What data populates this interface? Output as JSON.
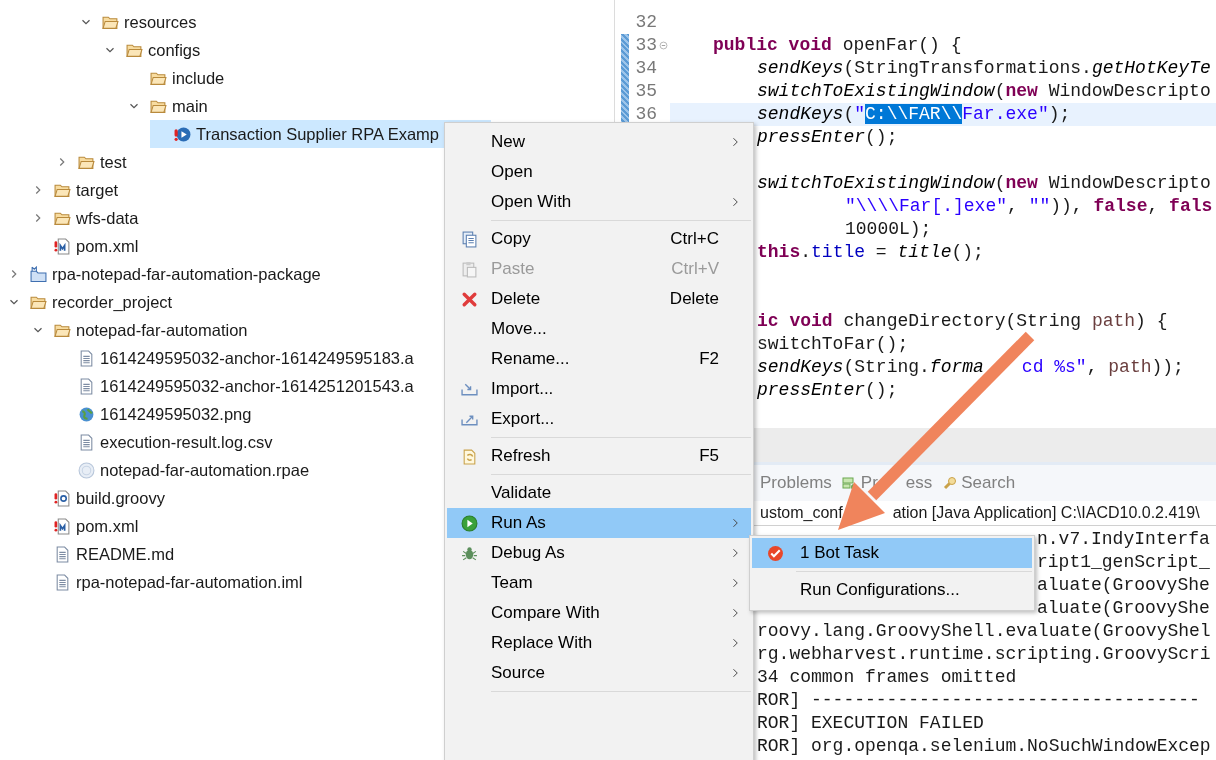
{
  "project_tree": {
    "items": [
      {
        "children": [
          {
            "children": [
              {
                "children": [
                  {
                    "label": "resources",
                    "kind": "folder",
                    "expanded": true,
                    "selected": false,
                    "children": [
                      {
                        "label": "configs",
                        "kind": "folder",
                        "expanded": true,
                        "selected": false,
                        "children": [
                          {
                            "label": "include",
                            "kind": "folder",
                            "selected": false
                          },
                          {
                            "label": "main",
                            "kind": "folder",
                            "expanded": true,
                            "selected": false,
                            "children": [
                              {
                                "label": "Transaction Supplier RPA Examp",
                                "kind": "bot",
                                "selected": true
                              }
                            ]
                          }
                        ]
                      }
                    ]
                  }
                ]
              },
              {
                "label": "test",
                "kind": "folder",
                "expanded": false,
                "selected": false
              }
            ]
          },
          {
            "label": "target",
            "kind": "folder",
            "expanded": false,
            "selected": false
          },
          {
            "label": "wfs-data",
            "kind": "folder",
            "expanded": false,
            "selected": false
          },
          {
            "label": "pom.xml",
            "kind": "maven",
            "selected": false
          }
        ]
      },
      {
        "label": "rpa-notepad-far-automation-package",
        "kind": "package",
        "expanded": false,
        "selected": false
      },
      {
        "label": "recorder_project",
        "kind": "folder",
        "expanded": true,
        "selected": false,
        "children": [
          {
            "label": "notepad-far-automation",
            "kind": "folder",
            "expanded": true,
            "selected": false,
            "children": [
              {
                "label": "1614249595032-anchor-1614249595183.a",
                "kind": "file",
                "selected": false
              },
              {
                "label": "1614249595032-anchor-1614251201543.a",
                "kind": "file",
                "selected": false
              },
              {
                "label": "1614249595032.png",
                "kind": "image",
                "selected": false
              },
              {
                "label": "execution-result.log.csv",
                "kind": "file",
                "selected": false
              },
              {
                "label": "notepad-far-automation.rpae",
                "kind": "rpae",
                "selected": false
              }
            ]
          },
          {
            "label": "build.groovy",
            "kind": "groovy",
            "selected": false
          },
          {
            "label": "pom.xml",
            "kind": "maven",
            "selected": false
          },
          {
            "label": "README.md",
            "kind": "file",
            "selected": false
          },
          {
            "label": "rpa-notepad-far-automation.iml",
            "kind": "file",
            "selected": false
          }
        ]
      }
    ]
  },
  "editor": {
    "lines": [
      {
        "number": "32",
        "kind": "member"
      },
      {
        "number": "33",
        "kind": "member",
        "changed": true,
        "foldable": true,
        "tokens": [
          {
            "text": "public void",
            "kind": "keyword"
          },
          {
            "text": " openFar() {",
            "kind": "plain"
          }
        ]
      },
      {
        "number": "34",
        "kind": "body",
        "changed": true,
        "tokens": [
          {
            "text": "sendKeys",
            "kind": "italic"
          },
          {
            "text": "(StringTransformations.",
            "kind": "plain"
          },
          {
            "text": "getHotKeyTe",
            "kind": "italic"
          }
        ]
      },
      {
        "number": "35",
        "kind": "body",
        "changed": true,
        "tokens": [
          {
            "text": "switchToExistingWindow",
            "kind": "italic"
          },
          {
            "text": "(",
            "kind": "plain"
          },
          {
            "text": "new",
            "kind": "keyword"
          },
          {
            "text": " WindowDescripto",
            "kind": "plain"
          }
        ]
      },
      {
        "number": "36",
        "kind": "body",
        "changed": true,
        "current": true,
        "tokens": [
          {
            "text": "sendKeys",
            "kind": "italic"
          },
          {
            "text": "(",
            "kind": "plain"
          },
          {
            "text": "\"",
            "kind": "string"
          },
          {
            "text": "C:\\\\FAR\\\\",
            "kind": "selection"
          },
          {
            "text": "Far.exe\"",
            "kind": "string"
          },
          {
            "text": ");",
            "kind": "plain"
          }
        ]
      },
      {
        "kind": "body",
        "tokens": [
          {
            "text": "pressEnter",
            "kind": "italic"
          },
          {
            "text": "();",
            "kind": "plain"
          }
        ]
      },
      {
        "kind": "body"
      },
      {
        "kind": "body",
        "tokens": [
          {
            "text": "switchToExistingWindow",
            "kind": "italic"
          },
          {
            "text": "(",
            "kind": "plain"
          },
          {
            "text": "new",
            "kind": "keyword"
          },
          {
            "text": " WindowDescripto",
            "kind": "plain"
          }
        ]
      },
      {
        "kind": "wrap",
        "tokens": [
          {
            "text": "\"\\\\\\\\Far[.]exe\"",
            "kind": "string"
          },
          {
            "text": ", ",
            "kind": "plain"
          },
          {
            "text": "\"\"",
            "kind": "string"
          },
          {
            "text": ")), ",
            "kind": "plain"
          },
          {
            "text": "false",
            "kind": "keyword"
          },
          {
            "text": ", ",
            "kind": "plain"
          },
          {
            "text": "fals",
            "kind": "keyword"
          }
        ]
      },
      {
        "kind": "wrap",
        "tokens": [
          {
            "text": "10000L);",
            "kind": "plain"
          }
        ]
      },
      {
        "kind": "body",
        "tokens": [
          {
            "text": "this",
            "kind": "keyword"
          },
          {
            "text": ".",
            "kind": "plain"
          },
          {
            "text": "title",
            "kind": "field"
          },
          {
            "text": " = ",
            "kind": "plain"
          },
          {
            "text": "title",
            "kind": "italic"
          },
          {
            "text": "();",
            "kind": "plain"
          }
        ]
      },
      {
        "kind": "body"
      },
      {
        "kind": "body"
      },
      {
        "kind": "body",
        "tokens": [
          {
            "text": "ic void",
            "kind": "keyword"
          },
          {
            "text": " changeDirectory(String ",
            "kind": "plain"
          },
          {
            "text": "path",
            "kind": "param"
          },
          {
            "text": ") {",
            "kind": "plain"
          }
        ]
      },
      {
        "kind": "body",
        "tokens": [
          {
            "text": "switchToFar();",
            "kind": "plain"
          }
        ]
      },
      {
        "kind": "body",
        "tokens": [
          {
            "text": "sendKeys",
            "kind": "italic"
          },
          {
            "text": "(String.",
            "kind": "plain"
          },
          {
            "text": "forma",
            "kind": "italic"
          },
          {
            "text": "cd %s\"",
            "kind": "gapstring"
          },
          {
            "text": ", ",
            "kind": "plain"
          },
          {
            "text": "path",
            "kind": "param"
          },
          {
            "text": "));",
            "kind": "plain"
          }
        ]
      },
      {
        "kind": "body",
        "tokens": [
          {
            "text": "pressEnter",
            "kind": "italic"
          },
          {
            "text": "();",
            "kind": "plain"
          }
        ]
      }
    ]
  },
  "bottom_panel": {
    "tabs": [
      {
        "label_parts": [
          "Problems"
        ],
        "kind": "plain",
        "selected": false
      },
      {
        "label_parts": [
          "Pr",
          "ess"
        ],
        "kind": "progress",
        "selected": false
      },
      {
        "label_parts": [
          "Search"
        ],
        "kind": "search",
        "selected": false
      }
    ],
    "console_title_parts": [
      "ustom_conf",
      "ation [Java Application] C:\\IACD10.0.2.419\\"
    ],
    "console_lines": [
      {
        "text": "n.v7.IndyInterfa",
        "kind": "beside"
      },
      {
        "text": "ript1_genScript_",
        "kind": "beside"
      },
      {
        "text": "aluate(GroovyShe",
        "kind": "beside"
      },
      {
        "text": "aluate(GroovyShe",
        "kind": "beside"
      },
      {
        "text": "roovy.lang.GroovyShell.evaluate(GroovyShel",
        "kind": "plain"
      },
      {
        "text": "rg.webharvest.runtime.scripting.GroovyScri",
        "kind": "plain"
      },
      {
        "text": "34 common frames omitted",
        "kind": "plain"
      },
      {
        "text": "ROR] ------------------------------------",
        "kind": "plain"
      },
      {
        "text": "ROR] EXECUTION FAILED",
        "kind": "plain"
      },
      {
        "text": "ROR] org.openqa.selenium.NoSuchWindowExcep",
        "kind": "plain"
      }
    ]
  },
  "context_menu": {
    "items": [
      {
        "kind": "plain",
        "label": "New",
        "submenu": true,
        "disabled": false,
        "selected": false
      },
      {
        "kind": "plain",
        "label": "Open",
        "disabled": false,
        "selected": false
      },
      {
        "kind": "plain",
        "label": "Open With",
        "submenu": true,
        "disabled": false,
        "selected": false
      },
      {
        "kind": "separator"
      },
      {
        "kind": "copy",
        "label": "Copy",
        "shortcut": "Ctrl+C",
        "disabled": false,
        "selected": false
      },
      {
        "kind": "paste",
        "label": "Paste",
        "shortcut": "Ctrl+V",
        "disabled": true,
        "selected": false
      },
      {
        "kind": "delete",
        "label": "Delete",
        "shortcut": "Delete",
        "disabled": false,
        "selected": false
      },
      {
        "kind": "plain",
        "label": "Move...",
        "disabled": false,
        "selected": false
      },
      {
        "kind": "plain",
        "label": "Rename...",
        "shortcut": "F2",
        "disabled": false,
        "selected": false
      },
      {
        "kind": "import",
        "label": "Import...",
        "disabled": false,
        "selected": false
      },
      {
        "kind": "export",
        "label": "Export...",
        "disabled": false,
        "selected": false
      },
      {
        "kind": "separator"
      },
      {
        "kind": "refresh",
        "label": "Refresh",
        "shortcut": "F5",
        "disabled": false,
        "selected": false
      },
      {
        "kind": "separator"
      },
      {
        "kind": "plain",
        "label": "Validate",
        "disabled": false,
        "selected": false
      },
      {
        "kind": "run",
        "label": "Run As",
        "submenu": true,
        "disabled": false,
        "selected": true
      },
      {
        "kind": "debug",
        "label": "Debug As",
        "submenu": true,
        "disabled": false,
        "selected": false
      },
      {
        "kind": "plain",
        "label": "Team",
        "submenu": true,
        "disabled": false,
        "selected": false
      },
      {
        "kind": "plain",
        "label": "Compare With",
        "submenu": true,
        "disabled": false,
        "selected": false
      },
      {
        "kind": "plain",
        "label": "Replace With",
        "submenu": true,
        "disabled": false,
        "selected": false
      },
      {
        "kind": "plain",
        "label": "Source",
        "submenu": true,
        "disabled": false,
        "selected": false
      },
      {
        "kind": "separator"
      }
    ]
  },
  "submenu": {
    "items": [
      {
        "kind": "task",
        "label": "1 Bot Task",
        "selected": true
      },
      {
        "kind": "separator"
      },
      {
        "kind": "plain",
        "label": "Run Configurations...",
        "selected": false
      }
    ]
  }
}
